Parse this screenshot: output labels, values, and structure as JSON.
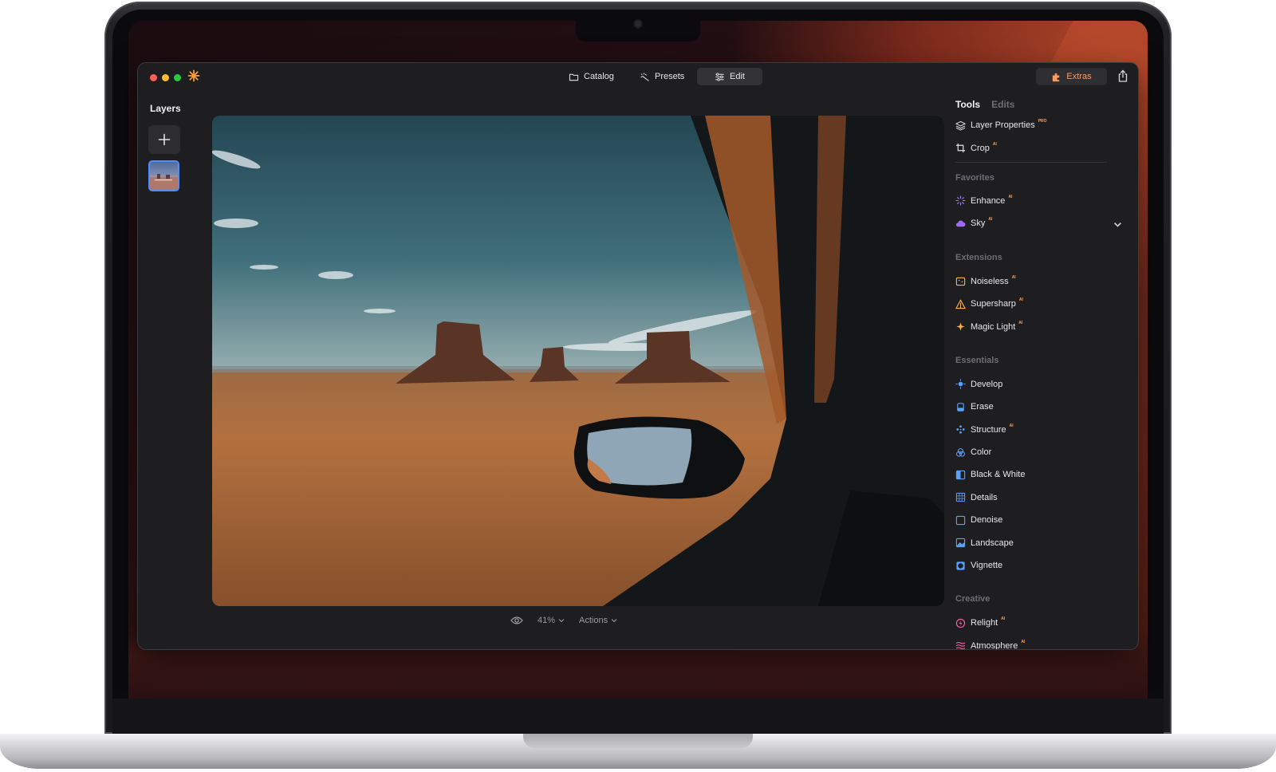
{
  "window": {
    "nav": {
      "catalog": "Catalog",
      "presets": "Presets",
      "edit": "Edit"
    },
    "extras_label": "Extras"
  },
  "layers": {
    "title": "Layers"
  },
  "toolbar_bottom": {
    "zoom": "41%",
    "actions": "Actions"
  },
  "panel": {
    "tabs": {
      "tools": "Tools",
      "edits": "Edits"
    },
    "top_items": [
      {
        "label": "Layer Properties",
        "badge": "PRO",
        "icon": "layers-icon"
      },
      {
        "label": "Crop",
        "badge": "AI",
        "icon": "crop-icon"
      }
    ],
    "sections": {
      "favorites": "Favorites",
      "extensions": "Extensions",
      "essentials": "Essentials",
      "creative": "Creative"
    },
    "favorites": [
      {
        "label": "Enhance",
        "badge": "AI",
        "icon": "enhance-icon"
      },
      {
        "label": "Sky",
        "badge": "AI",
        "icon": "cloud-icon"
      }
    ],
    "extensions": [
      {
        "label": "Noiseless",
        "badge": "AI",
        "icon": "noiseless-icon"
      },
      {
        "label": "Supersharp",
        "badge": "AI",
        "icon": "supersharp-icon"
      },
      {
        "label": "Magic Light",
        "badge": "AI",
        "icon": "magic-light-icon"
      }
    ],
    "essentials": [
      {
        "label": "Develop",
        "icon": "sun-icon"
      },
      {
        "label": "Erase",
        "icon": "eraser-icon"
      },
      {
        "label": "Structure",
        "badge": "AI",
        "icon": "structure-icon"
      },
      {
        "label": "Color",
        "icon": "color-icon"
      },
      {
        "label": "Black & White",
        "icon": "black-white-icon"
      },
      {
        "label": "Details",
        "icon": "details-icon"
      },
      {
        "label": "Denoise",
        "icon": "denoise-icon"
      },
      {
        "label": "Landscape",
        "icon": "landscape-icon"
      },
      {
        "label": "Vignette",
        "icon": "vignette-icon"
      }
    ],
    "creative": [
      {
        "label": "Relight",
        "badge": "AI",
        "icon": "relight-icon"
      },
      {
        "label": "Atmosphere",
        "badge": "AI",
        "icon": "atmosphere-icon"
      }
    ]
  },
  "colors": {
    "accent_orange": "#ff9a5a",
    "accent_blue": "#4d8dff",
    "accent_purple": "#9b6bff",
    "window_bg": "#1e1e21"
  }
}
